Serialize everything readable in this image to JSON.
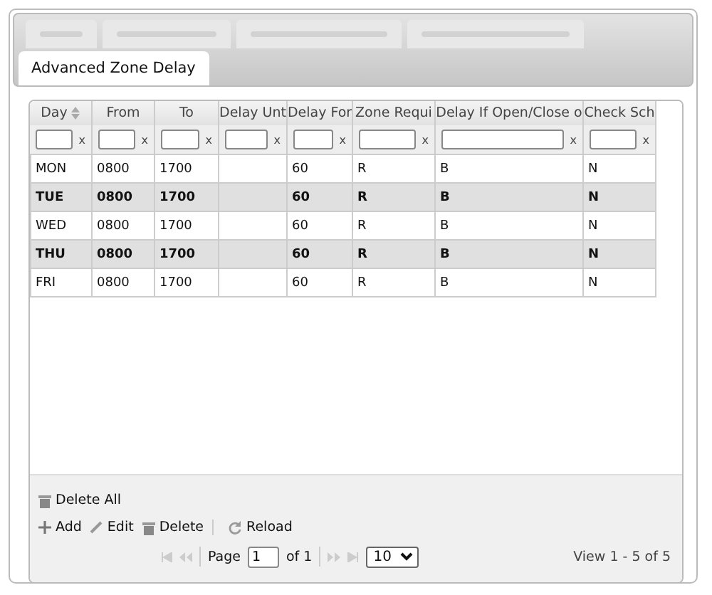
{
  "tabs": [
    {
      "label": "Advanced Zone Delay",
      "selected": true
    }
  ],
  "table": {
    "columns": [
      {
        "label": "Day",
        "sortable": true,
        "clear": "x"
      },
      {
        "label": "From",
        "sortable": false,
        "clear": "x"
      },
      {
        "label": "To",
        "sortable": false,
        "clear": "x"
      },
      {
        "label": "Delay Unt",
        "sortable": false,
        "clear": "x"
      },
      {
        "label": "Delay For",
        "sortable": false,
        "clear": "x"
      },
      {
        "label": "Zone Requi",
        "sortable": false,
        "clear": "x"
      },
      {
        "label": "Delay If Open/Close o",
        "sortable": false,
        "clear": "x"
      },
      {
        "label": "Check Sch",
        "sortable": false,
        "clear": "x"
      }
    ],
    "rows": [
      {
        "shaded": false,
        "cells": [
          "MON",
          "0800",
          "1700",
          "",
          "60",
          "R",
          "B",
          "N"
        ]
      },
      {
        "shaded": true,
        "cells": [
          "TUE",
          "0800",
          "1700",
          "",
          "60",
          "R",
          "B",
          "N"
        ]
      },
      {
        "shaded": false,
        "cells": [
          "WED",
          "0800",
          "1700",
          "",
          "60",
          "R",
          "B",
          "N"
        ]
      },
      {
        "shaded": true,
        "cells": [
          "THU",
          "0800",
          "1700",
          "",
          "60",
          "R",
          "B",
          "N"
        ]
      },
      {
        "shaded": false,
        "cells": [
          "FRI",
          "0800",
          "1700",
          "",
          "60",
          "R",
          "B",
          "N"
        ]
      }
    ]
  },
  "toolbar": {
    "delete_all": "Delete All",
    "actions": [
      {
        "kind": "add",
        "label": "Add"
      },
      {
        "kind": "edit",
        "label": "Edit"
      },
      {
        "kind": "delete",
        "label": "Delete"
      },
      {
        "kind": "reload",
        "label": "Reload"
      }
    ]
  },
  "pager": {
    "page_label": "Page",
    "page": "1",
    "of": "of 1",
    "page_size": "10",
    "summary": "View 1 - 5 of 5"
  }
}
